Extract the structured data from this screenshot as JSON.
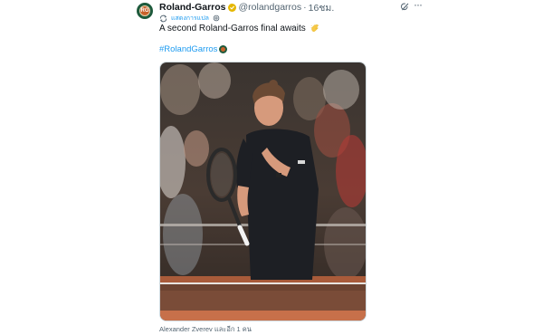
{
  "author": {
    "display_name": "Roland-Garros",
    "handle": "@roland‌garros",
    "separator": "·",
    "time": "16ชม."
  },
  "translate": {
    "label": "แสดงการแปล"
  },
  "tweet": {
    "text": "A second Roland-Garros final awaits",
    "hashtag": "#RolandGarros"
  },
  "media": {
    "caption": "Alexander Zverev และอีก 1 คน"
  },
  "colors": {
    "link": "#1d9bf0",
    "secondary_text": "#536471",
    "verified_gold": "#e5b700",
    "clay": "#c8622b",
    "brand_green": "#1e5a3c"
  },
  "icons": {
    "avatar": "roland-garros-logo",
    "verified": "verified-badge-icon",
    "grok": "grok-icon",
    "more": "more-icon",
    "translate": "translate-icon",
    "settings": "gear-icon",
    "wave": "waving-hand-emoji",
    "hashflag": "roland-garros-hashflag"
  }
}
